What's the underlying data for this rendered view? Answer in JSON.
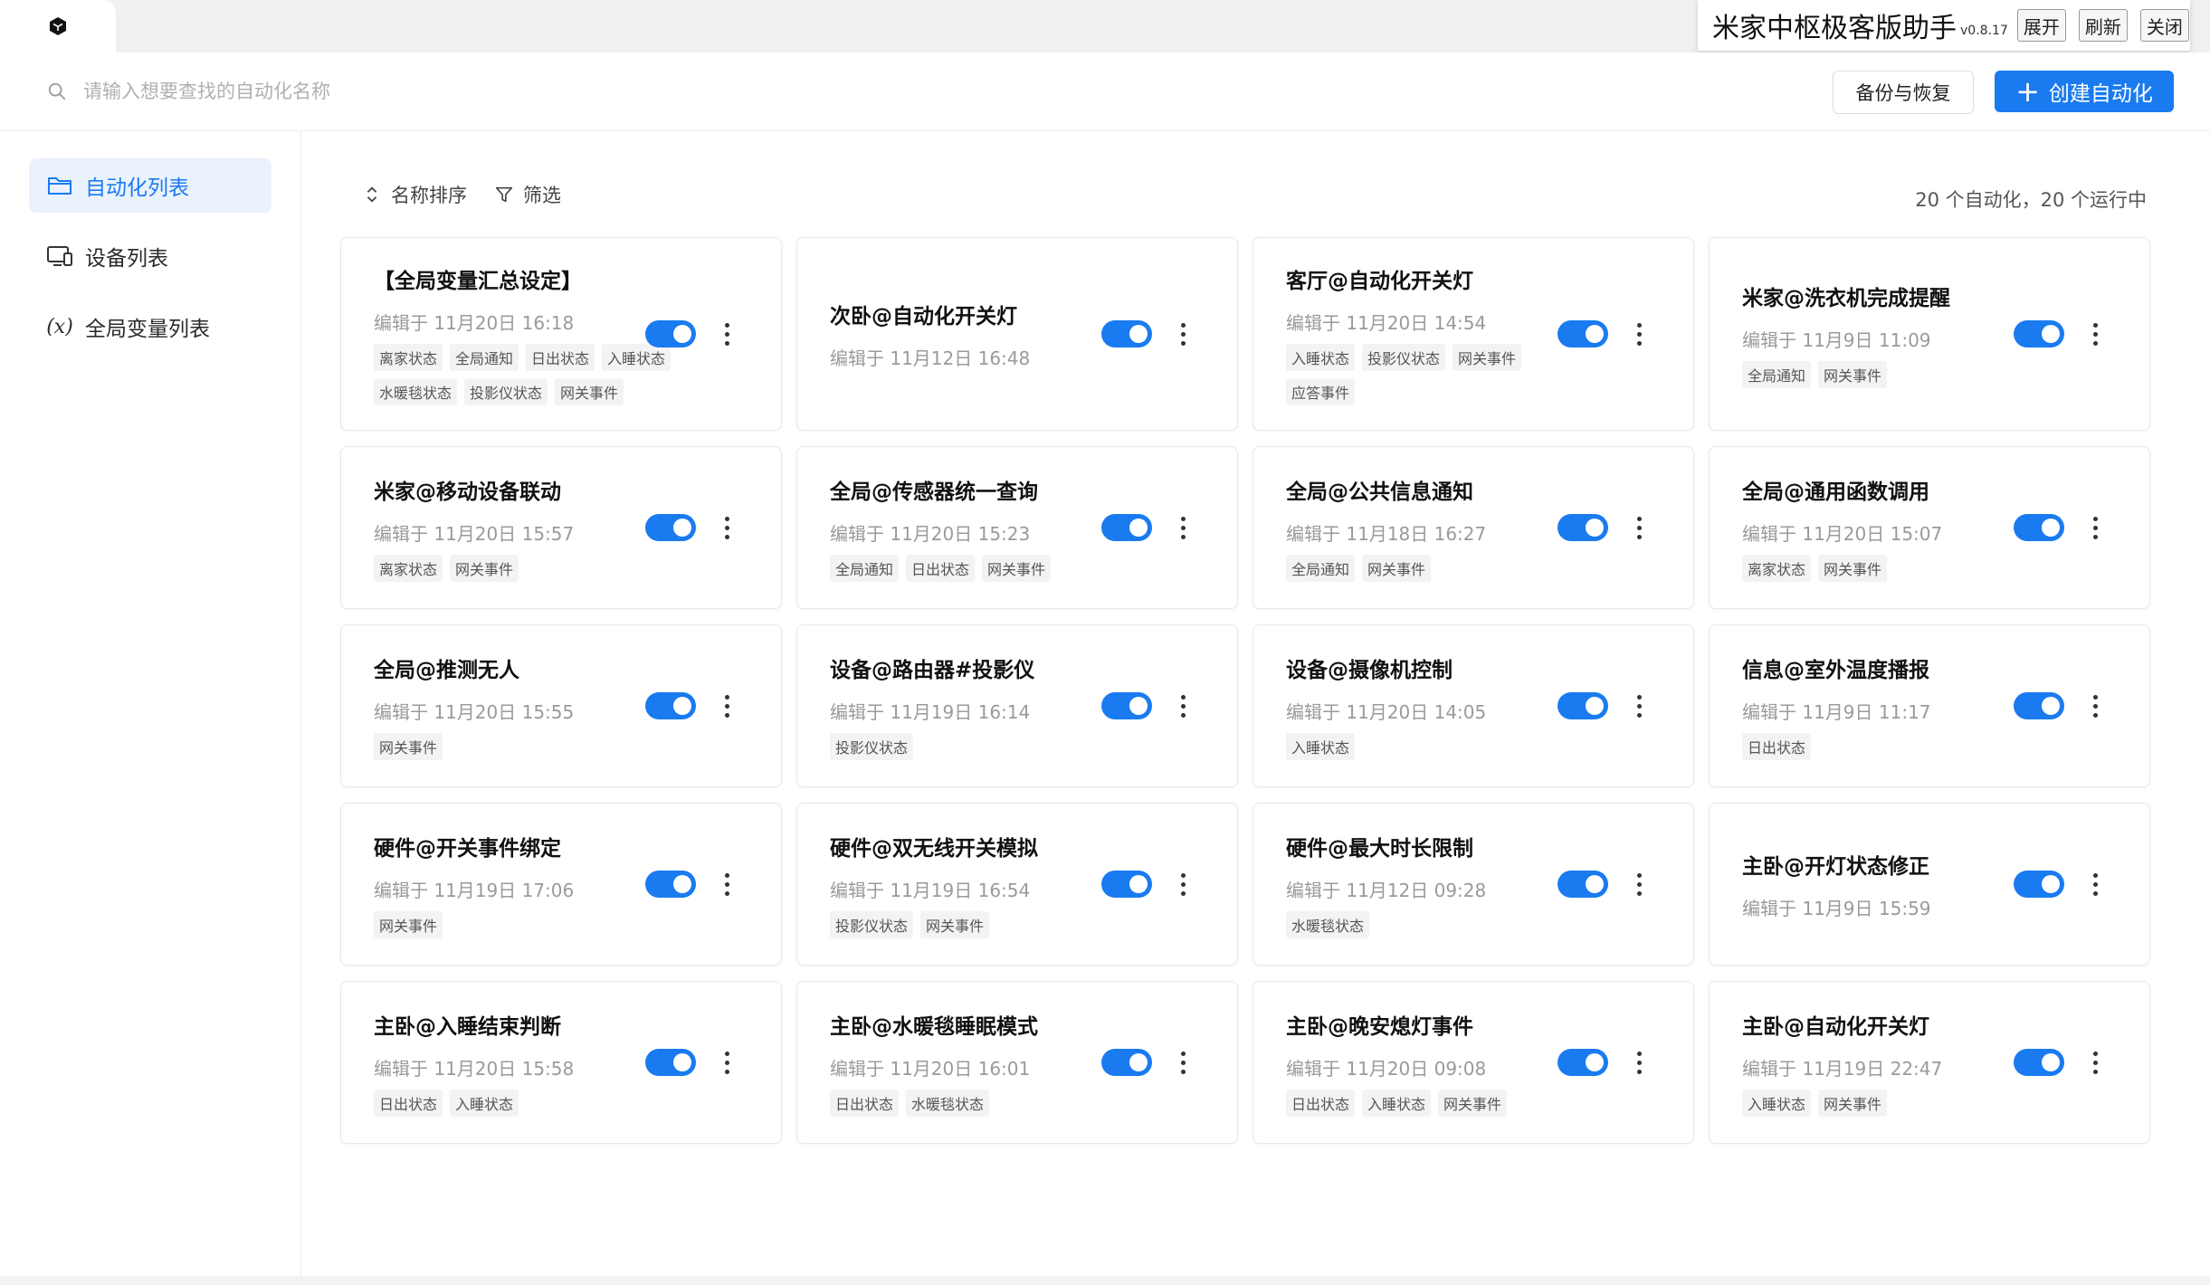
{
  "helper": {
    "title": "米家中枢极客版助手",
    "version": "v0.8.17",
    "buttons": [
      "展开",
      "刷新",
      "关闭"
    ]
  },
  "header": {
    "search_placeholder": "请输入想要查找的自动化名称",
    "backup_label": "备份与恢复",
    "create_label": "创建自动化"
  },
  "sidebar": {
    "items": [
      {
        "label": "自动化列表",
        "active": true
      },
      {
        "label": "设备列表",
        "active": false
      },
      {
        "label": "全局变量列表",
        "active": false
      }
    ]
  },
  "toolbar": {
    "sort_label": "名称排序",
    "filter_label": "筛选",
    "count_text": "20 个自动化，20 个运行中"
  },
  "colors": {
    "accent": "#1a7bf0",
    "sidebar_active_bg": "#eaf2fd"
  },
  "cards": [
    {
      "title": "【全局变量汇总设定】",
      "time": "编辑于 11月20日 16:18",
      "tags": [
        "离家状态",
        "全局通知",
        "日出状态",
        "入睡状态",
        "水暖毯状态",
        "投影仪状态",
        "网关事件"
      ],
      "enabled": true
    },
    {
      "title": "次卧@自动化开关灯",
      "time": "编辑于 11月12日 16:48",
      "tags": [],
      "enabled": true
    },
    {
      "title": "客厅@自动化开关灯",
      "time": "编辑于 11月20日 14:54",
      "tags": [
        "入睡状态",
        "投影仪状态",
        "网关事件",
        "应答事件"
      ],
      "enabled": true
    },
    {
      "title": "米家@洗衣机完成提醒",
      "time": "编辑于 11月9日 11:09",
      "tags": [
        "全局通知",
        "网关事件"
      ],
      "enabled": true
    },
    {
      "title": "米家@移动设备联动",
      "time": "编辑于 11月20日 15:57",
      "tags": [
        "离家状态",
        "网关事件"
      ],
      "enabled": true
    },
    {
      "title": "全局@传感器统一查询",
      "time": "编辑于 11月20日 15:23",
      "tags": [
        "全局通知",
        "日出状态",
        "网关事件"
      ],
      "enabled": true
    },
    {
      "title": "全局@公共信息通知",
      "time": "编辑于 11月18日 16:27",
      "tags": [
        "全局通知",
        "网关事件"
      ],
      "enabled": true
    },
    {
      "title": "全局@通用函数调用",
      "time": "编辑于 11月20日 15:07",
      "tags": [
        "离家状态",
        "网关事件"
      ],
      "enabled": true
    },
    {
      "title": "全局@推测无人",
      "time": "编辑于 11月20日 15:55",
      "tags": [
        "网关事件"
      ],
      "enabled": true
    },
    {
      "title": "设备@路由器#投影仪",
      "time": "编辑于 11月19日 16:14",
      "tags": [
        "投影仪状态"
      ],
      "enabled": true
    },
    {
      "title": "设备@摄像机控制",
      "time": "编辑于 11月20日 14:05",
      "tags": [
        "入睡状态"
      ],
      "enabled": true
    },
    {
      "title": "信息@室外温度播报",
      "time": "编辑于 11月9日 11:17",
      "tags": [
        "日出状态"
      ],
      "enabled": true
    },
    {
      "title": "硬件@开关事件绑定",
      "time": "编辑于 11月19日 17:06",
      "tags": [
        "网关事件"
      ],
      "enabled": true
    },
    {
      "title": "硬件@双无线开关模拟",
      "time": "编辑于 11月19日 16:54",
      "tags": [
        "投影仪状态",
        "网关事件"
      ],
      "enabled": true
    },
    {
      "title": "硬件@最大时长限制",
      "time": "编辑于 11月12日 09:28",
      "tags": [
        "水暖毯状态"
      ],
      "enabled": true
    },
    {
      "title": "主卧@开灯状态修正",
      "time": "编辑于 11月9日 15:59",
      "tags": [],
      "enabled": true
    },
    {
      "title": "主卧@入睡结束判断",
      "time": "编辑于 11月20日 15:58",
      "tags": [
        "日出状态",
        "入睡状态"
      ],
      "enabled": true
    },
    {
      "title": "主卧@水暖毯睡眠模式",
      "time": "编辑于 11月20日 16:01",
      "tags": [
        "日出状态",
        "水暖毯状态"
      ],
      "enabled": true
    },
    {
      "title": "主卧@晚安熄灯事件",
      "time": "编辑于 11月20日 09:08",
      "tags": [
        "日出状态",
        "入睡状态",
        "网关事件"
      ],
      "enabled": true
    },
    {
      "title": "主卧@自动化开关灯",
      "time": "编辑于 11月19日 22:47",
      "tags": [
        "入睡状态",
        "网关事件"
      ],
      "enabled": true
    }
  ]
}
